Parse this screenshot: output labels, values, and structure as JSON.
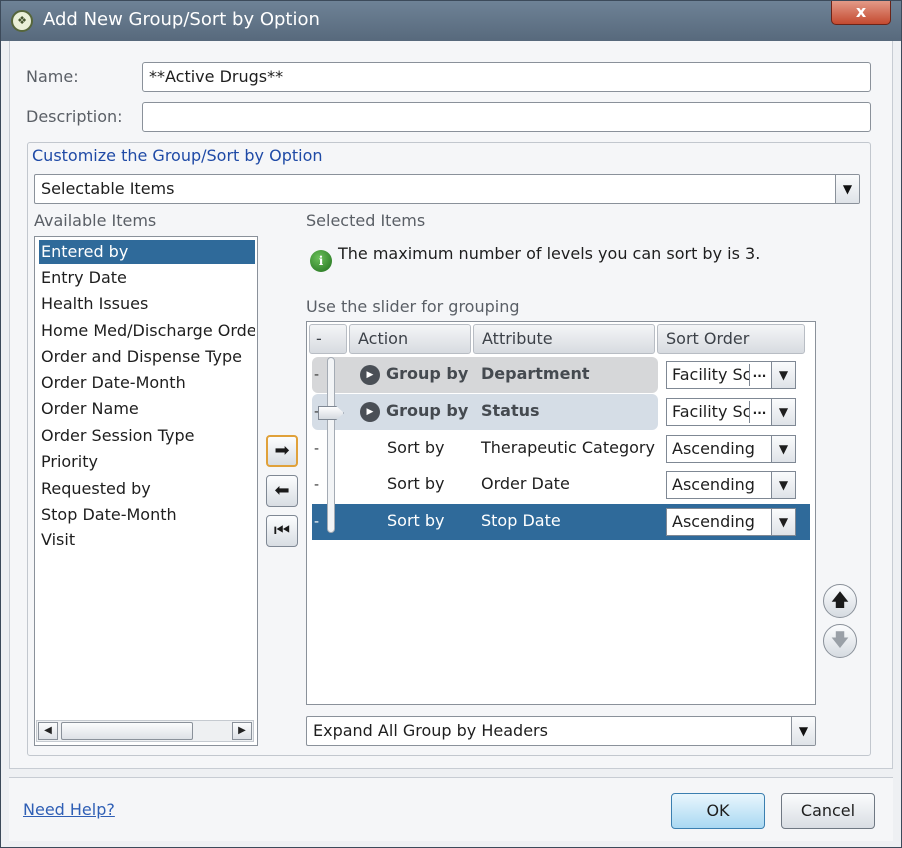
{
  "window": {
    "title": "Add New Group/Sort by Option",
    "close_label": "x"
  },
  "form": {
    "name_label": "Name:",
    "name_value": "**Active Drugs**",
    "description_label": "Description:",
    "description_value": ""
  },
  "customize": {
    "title": "Customize the Group/Sort by Option",
    "items_combo": "Selectable Items"
  },
  "available": {
    "label": "Available Items",
    "items": [
      "Entered by",
      "Entry Date",
      "Health Issues",
      "Home Med/Discharge Orde",
      "Order and Dispense Type",
      "Order Date-Month",
      "Order Name",
      "Order Session Type",
      "Priority",
      "Requested by",
      "Stop Date-Month",
      "Visit"
    ],
    "selected_index": 0
  },
  "selected": {
    "label": "Selected Items",
    "info_text": "The maximum number of levels you can sort by is 3.",
    "slider_hint": "Use the slider for grouping",
    "columns": {
      "dash": "-",
      "action": "Action",
      "attribute": "Attribute",
      "sort_order": "Sort Order"
    },
    "rows": [
      {
        "dash": "-",
        "action": "Group by",
        "attribute": "Department",
        "sort_order": "Facility Sc",
        "ellipsis": "...",
        "type": "group"
      },
      {
        "dash": "-",
        "action": "Group by",
        "attribute": "Status",
        "sort_order": "Facility Sc",
        "ellipsis": "...",
        "type": "group"
      },
      {
        "dash": "-",
        "action": "Sort by",
        "attribute": "Therapeutic Category",
        "sort_order": "Ascending",
        "type": "sort"
      },
      {
        "dash": "-",
        "action": "Sort by",
        "attribute": "Order Date",
        "sort_order": "Ascending",
        "type": "sort"
      },
      {
        "dash": "-",
        "action": "Sort by",
        "attribute": "Stop Date",
        "sort_order": "Ascending",
        "type": "selected"
      }
    ],
    "expand_combo": "Expand All Group by Headers"
  },
  "footer": {
    "help_link": "Need Help?",
    "ok_label": "OK",
    "cancel_label": "Cancel"
  },
  "colors": {
    "selection": "#2f6a9a",
    "group_title": "#1f4aa6",
    "link": "#2f5fb5"
  }
}
